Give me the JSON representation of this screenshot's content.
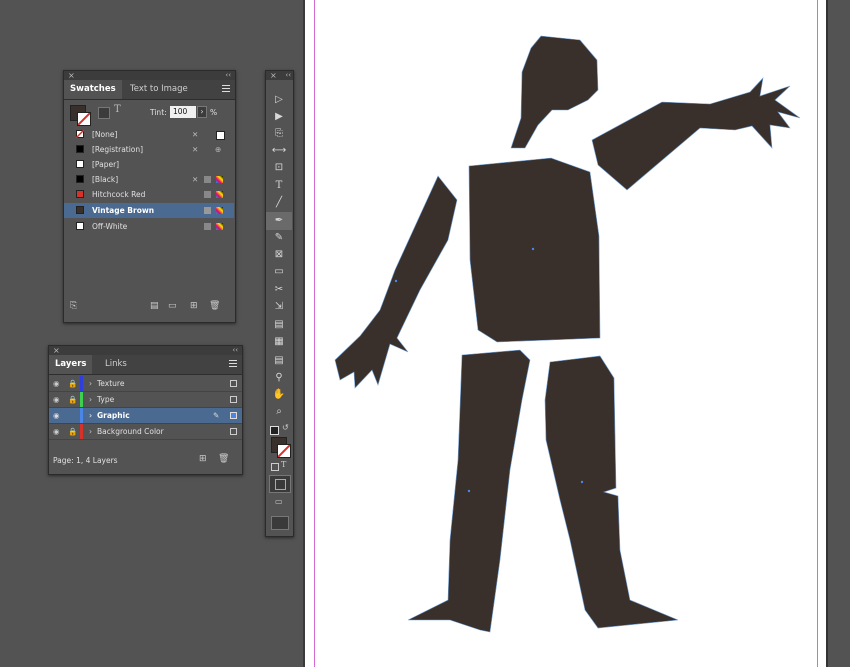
{
  "swatches_panel": {
    "tabs": [
      "Swatches",
      "Text to Image"
    ],
    "tint_label": "Tint:",
    "tint_value": "100",
    "tint_unit": "%",
    "items": [
      {
        "name": "[None]",
        "color": "none"
      },
      {
        "name": "[Registration]",
        "color": "#000000"
      },
      {
        "name": "[Paper]",
        "color": "#ffffff"
      },
      {
        "name": "[Black]",
        "color": "#000000"
      },
      {
        "name": "Hitchcock Red",
        "color": "#d7322a"
      },
      {
        "name": "Vintage Brown",
        "color": "#39302b"
      },
      {
        "name": "Off-White",
        "color": "#ffffff"
      }
    ],
    "selected": "Vintage Brown"
  },
  "layers_panel": {
    "tabs": [
      "Layers",
      "Links"
    ],
    "layers": [
      {
        "name": "Texture",
        "color": "#2f3fdc",
        "locked": true
      },
      {
        "name": "Type",
        "color": "#3fcf4f",
        "locked": true
      },
      {
        "name": "Graphic",
        "color": "#4a86e8",
        "locked": false
      },
      {
        "name": "Background Color",
        "color": "#d7322a",
        "locked": true
      }
    ],
    "selected": "Graphic",
    "status": "Page: 1, 4 Layers"
  },
  "toolbar": {
    "tools": [
      "selection-tool",
      "direct-selection-tool",
      "page-tool",
      "gap-tool",
      "content-collector-tool",
      "type-tool",
      "line-tool",
      "pen-tool",
      "pencil-tool",
      "rectangle-frame-tool",
      "rectangle-tool",
      "scissors-tool",
      "free-transform-tool",
      "gradient-swatch-tool",
      "gradient-feather-tool",
      "note-tool",
      "eyedropper-tool",
      "hand-tool",
      "zoom-tool"
    ],
    "active": "pen-tool"
  },
  "colors": {
    "fill": "#39302b",
    "figure": "#39302b",
    "selection": "#4a86e8"
  }
}
